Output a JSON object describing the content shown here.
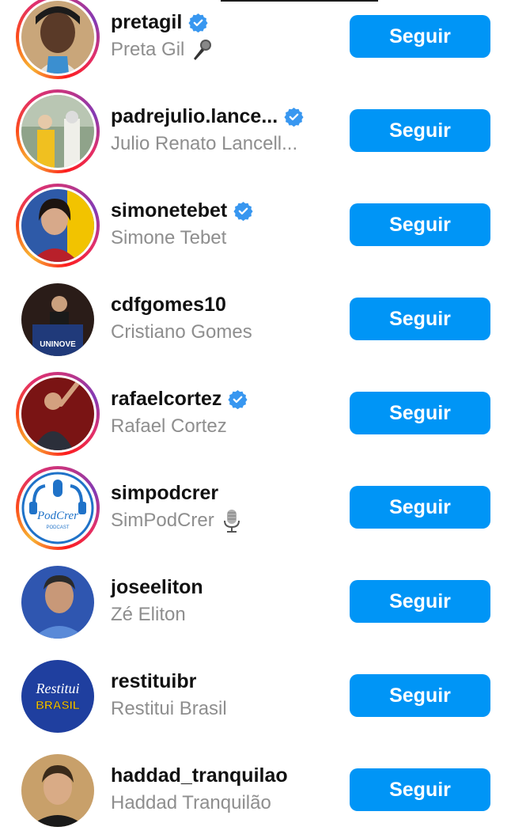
{
  "follow_label": "Seguir",
  "icons": {
    "verified": "verified-badge-icon",
    "mic": "microphone-emoji-icon",
    "studio_mic": "studio-microphone-emoji-icon"
  },
  "colors": {
    "button": "#0095f6",
    "verified": "#3897f0",
    "muted_text": "#8e8e8e"
  },
  "suggestions": [
    {
      "username": "pretagil",
      "full_name": "Preta Gil",
      "verified": true,
      "emoji": "mic",
      "story_ring": true
    },
    {
      "username": "padrejulio.lance...",
      "full_name": "Julio Renato Lancell...",
      "verified": true,
      "story_ring": true
    },
    {
      "username": "simonetebet",
      "full_name": "Simone Tebet",
      "verified": true,
      "story_ring": true
    },
    {
      "username": "cdfgomes10",
      "full_name": "Cristiano Gomes",
      "verified": false,
      "story_ring": false,
      "avatar_text": "UNINOVE"
    },
    {
      "username": "rafaelcortez",
      "full_name": "Rafael Cortez",
      "verified": true,
      "story_ring": true
    },
    {
      "username": "simpodcrer",
      "full_name": "SimPodCrer",
      "verified": false,
      "emoji": "studio_mic",
      "story_ring": true,
      "avatar_text": "PodCrer",
      "avatar_subtext": "PODCAST"
    },
    {
      "username": "joseeliton",
      "full_name": "Zé Eliton",
      "verified": false,
      "story_ring": false
    },
    {
      "username": "restituibr",
      "full_name": "Restitui Brasil",
      "verified": false,
      "story_ring": false,
      "avatar_text": "Restitui",
      "avatar_subtext": "BRASIL"
    },
    {
      "username": "haddad_tranquilao",
      "full_name": "Haddad Tranquilão",
      "verified": false,
      "story_ring": false
    }
  ]
}
